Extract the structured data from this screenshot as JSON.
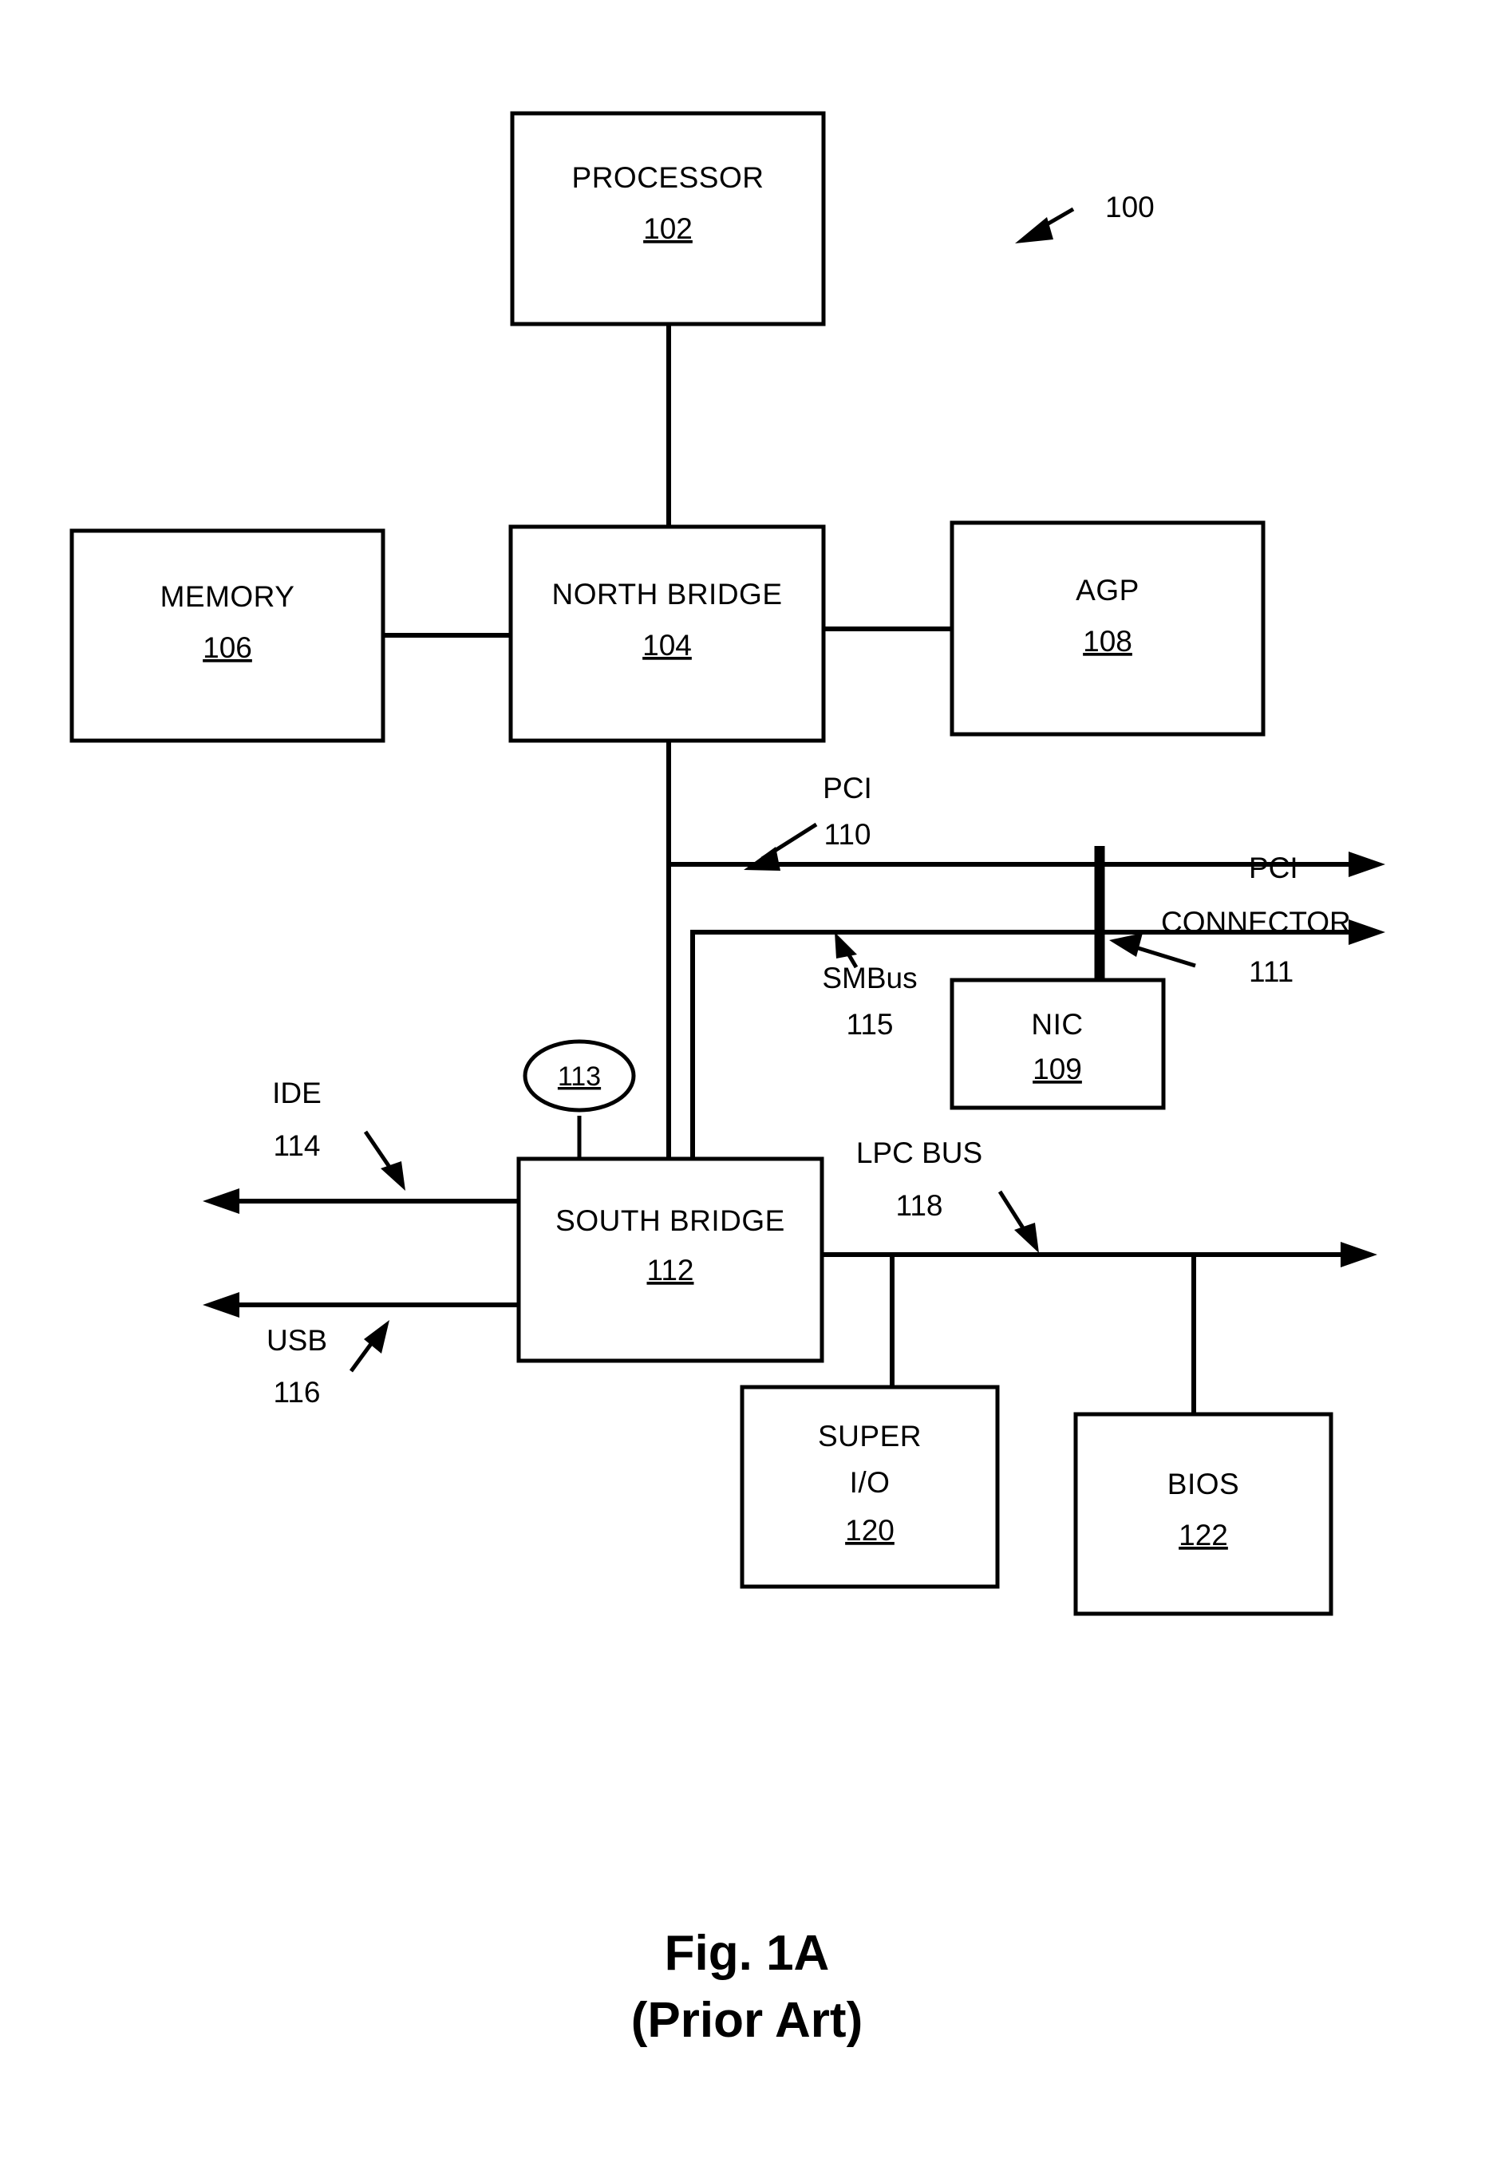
{
  "figure": {
    "caption_line1": "Fig. 1A",
    "caption_line2": "(Prior Art)",
    "system_ref": "100"
  },
  "blocks": [
    {
      "id": "processor",
      "label": "PROCESSOR",
      "ref": "102"
    },
    {
      "id": "memory",
      "label": "MEMORY",
      "ref": "106"
    },
    {
      "id": "north_bridge",
      "label": "NORTH BRIDGE",
      "ref": "104"
    },
    {
      "id": "agp",
      "label": "AGP",
      "ref": "108"
    },
    {
      "id": "nic",
      "label": "NIC",
      "ref": "109"
    },
    {
      "id": "south_bridge",
      "label": "SOUTH BRIDGE",
      "ref": "112"
    },
    {
      "id": "super_io",
      "label_line1": "SUPER",
      "label_line2": "I/O",
      "ref": "120"
    },
    {
      "id": "bios",
      "label": "BIOS",
      "ref": "122"
    }
  ],
  "buses": {
    "pci": {
      "label": "PCI",
      "ref": "110"
    },
    "smbus": {
      "label": "SMBus",
      "ref": "115"
    },
    "pci_conn": {
      "label_line1": "PCI",
      "label_line2": "CONNECTOR",
      "ref": "111"
    },
    "ide": {
      "label": "IDE",
      "ref": "114"
    },
    "usb": {
      "label": "USB",
      "ref": "116"
    },
    "lpc": {
      "label": "LPC BUS",
      "ref": "118"
    }
  },
  "callouts": {
    "south_bridge_oval": "113"
  },
  "colors": {
    "ink": "#000000",
    "paper": "#ffffff"
  }
}
